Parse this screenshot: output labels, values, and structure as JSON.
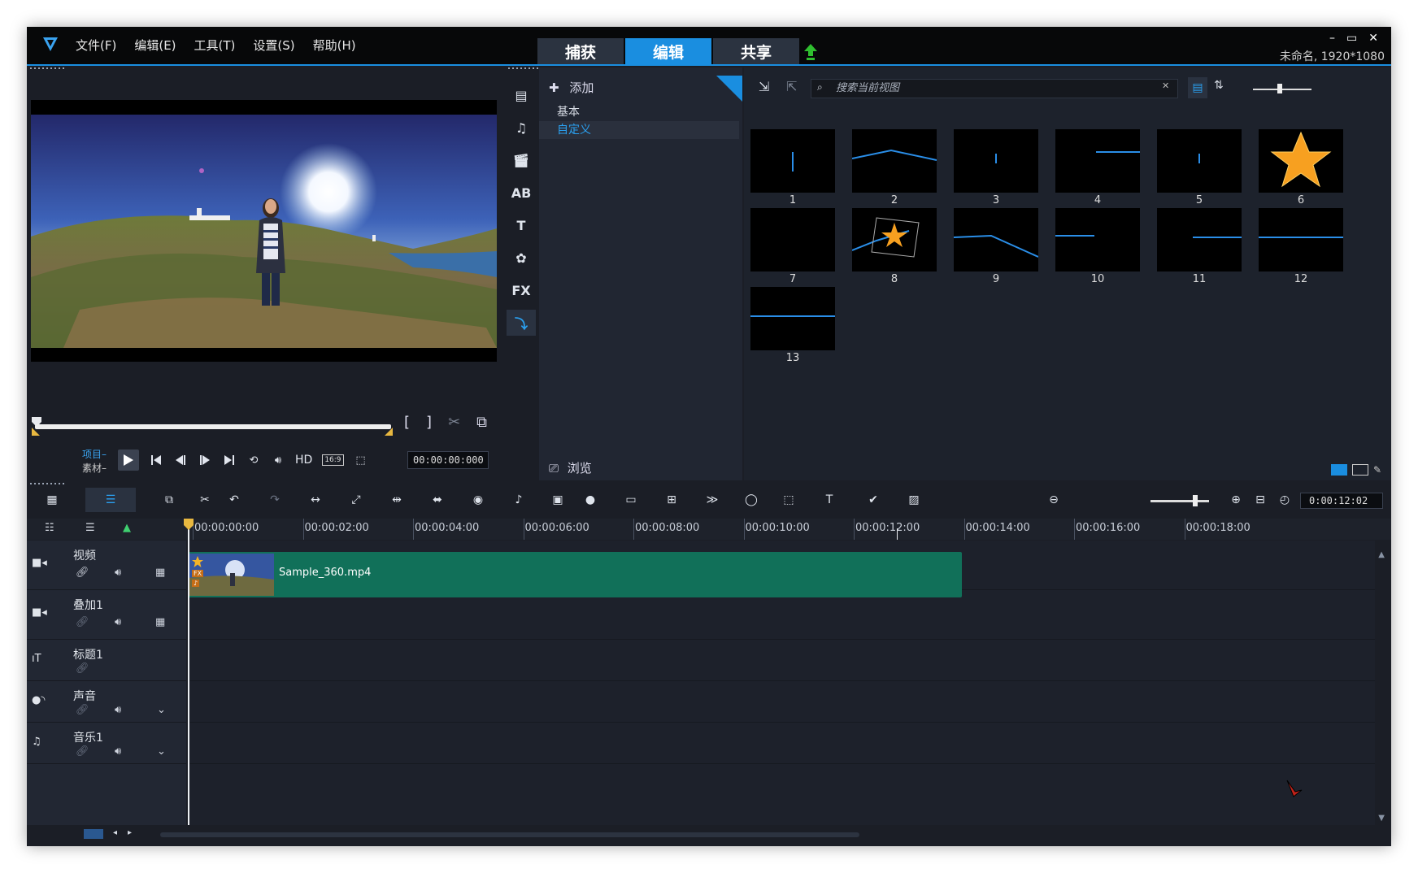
{
  "window": {
    "menu": [
      "文件(F)",
      "编辑(E)",
      "工具(T)",
      "设置(S)",
      "帮助(H)"
    ],
    "mode_tabs": [
      "捕获",
      "编辑",
      "共享"
    ],
    "active_tab": "编辑",
    "project_info": "未命名, 1920*1080",
    "controls": [
      "–",
      "▭",
      "✕"
    ]
  },
  "player": {
    "project_label": "项目–",
    "clip_label": "素材–",
    "trim_in": "[",
    "trim_out": "]",
    "hd_label": "HD",
    "ratio_label": "16:9",
    "timecode": "00:00:00:000"
  },
  "library": {
    "add_label": "添加",
    "categories": [
      "基本",
      "自定义"
    ],
    "selected_category": "自定义",
    "browse_label": "浏览",
    "search_placeholder": "搜索当前视图",
    "thumbnails": [
      "1",
      "2",
      "3",
      "4",
      "5",
      "6",
      "7",
      "8",
      "9",
      "10",
      "11",
      "12",
      "13"
    ]
  },
  "timeline": {
    "duration": "0:00:12:02",
    "ruler": [
      "00:00:00:00",
      "00:00:02:00",
      "00:00:04:00",
      "00:00:06:00",
      "00:00:08:00",
      "00:00:10:00",
      "00:00:12:00",
      "00:00:14:00",
      "00:00:16:00",
      "00:00:18:00"
    ],
    "tracks": [
      {
        "name": "视频"
      },
      {
        "name": "叠加1"
      },
      {
        "name": "标题1"
      },
      {
        "name": "声音"
      },
      {
        "name": "音乐1"
      }
    ],
    "clip_name": "Sample_360.mp4",
    "fx_badge": "FX"
  },
  "colors": {
    "accent": "#1a8ee0",
    "clip": "#117059",
    "background": "#1b1e26"
  }
}
